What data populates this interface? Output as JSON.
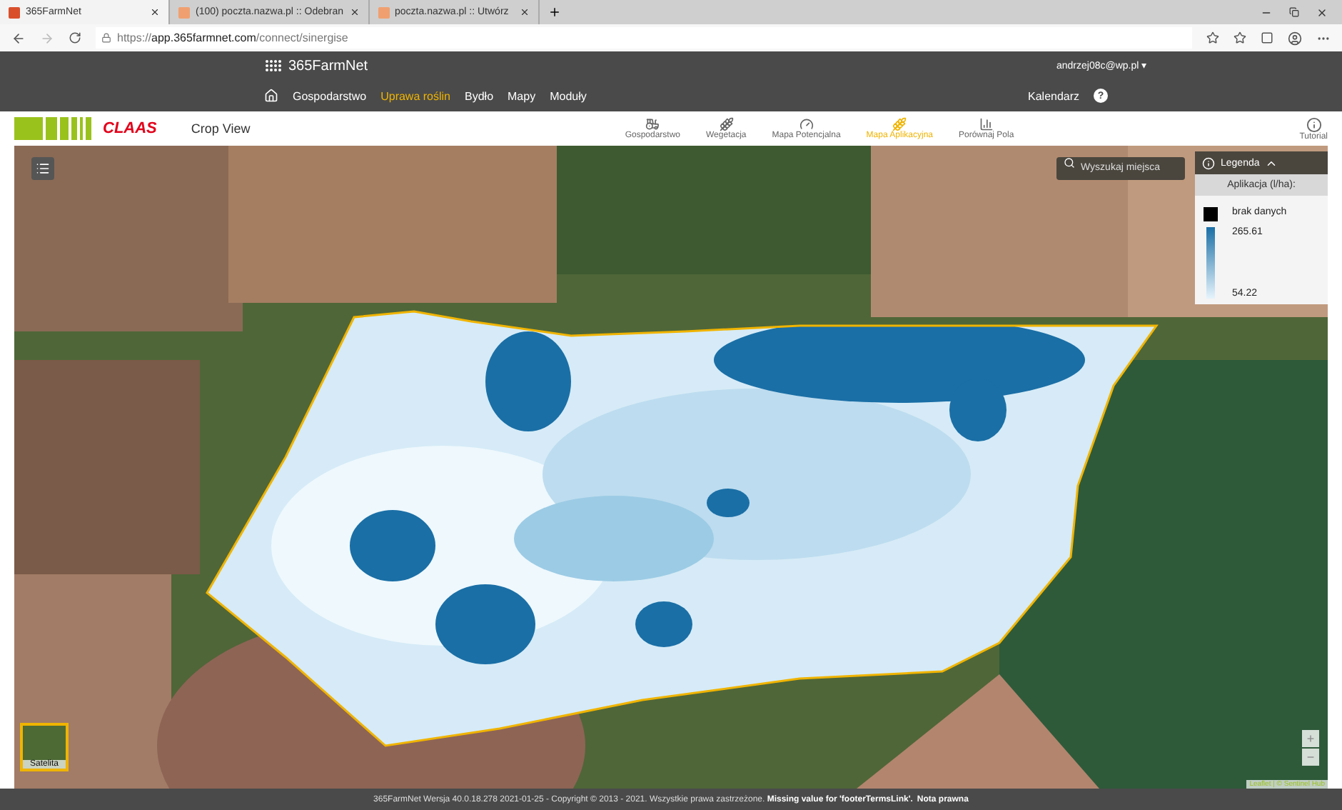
{
  "browser": {
    "tabs": [
      {
        "title": "365FarmNet",
        "selected": true
      },
      {
        "title": "(100) poczta.nazwa.pl :: Odebran",
        "selected": false
      },
      {
        "title": "poczta.nazwa.pl :: Utwórz",
        "selected": false
      }
    ],
    "url": "https://**app.365farmnet.com**/connect/sinergise"
  },
  "header": {
    "logo": "365FarmNet",
    "user": "andrzej08c@wp.pl",
    "user_caret": "▾",
    "calendar": "Kalendarz",
    "help": "?",
    "nav": [
      {
        "label": "Gospodarstwo",
        "selected": false
      },
      {
        "label": "Uprawa roślin",
        "selected": true
      },
      {
        "label": "Bydło",
        "selected": false
      },
      {
        "label": "Mapy",
        "selected": false
      },
      {
        "label": "Moduły",
        "selected": false
      }
    ]
  },
  "appbar": {
    "brand": "CLAAS",
    "title": "Crop View",
    "tutorial": "Tutorial",
    "tools": [
      {
        "label": "Gospodarstwo",
        "selected": false
      },
      {
        "label": "Wegetacja",
        "selected": false
      },
      {
        "label": "Mapa Potencjalna",
        "selected": false
      },
      {
        "label": "Mapa Aplikacyjna",
        "selected": true
      },
      {
        "label": "Porównaj Pola",
        "selected": false
      }
    ]
  },
  "map": {
    "search": {
      "placeholder": "Wyszukaj miejsca"
    },
    "legend": {
      "title": "Legenda",
      "expanded": true,
      "unit": "Aplikacja (l/ha):",
      "nodata": "brak danych",
      "max": "265.61",
      "min": "54.22"
    },
    "layer": "Satelita",
    "zoom_in": "+",
    "zoom_out": "−",
    "attribution": "Leaflet | © Sentinel Hub"
  },
  "footer": {
    "text": "365FarmNet Wersja 40.0.18.278 2021-01-25 - Copyright © 2013 - 2021. Wszystkie prawa zastrzeżone. **Missing value for 'footerTermsLink'.**",
    "link": "Nota prawna"
  }
}
